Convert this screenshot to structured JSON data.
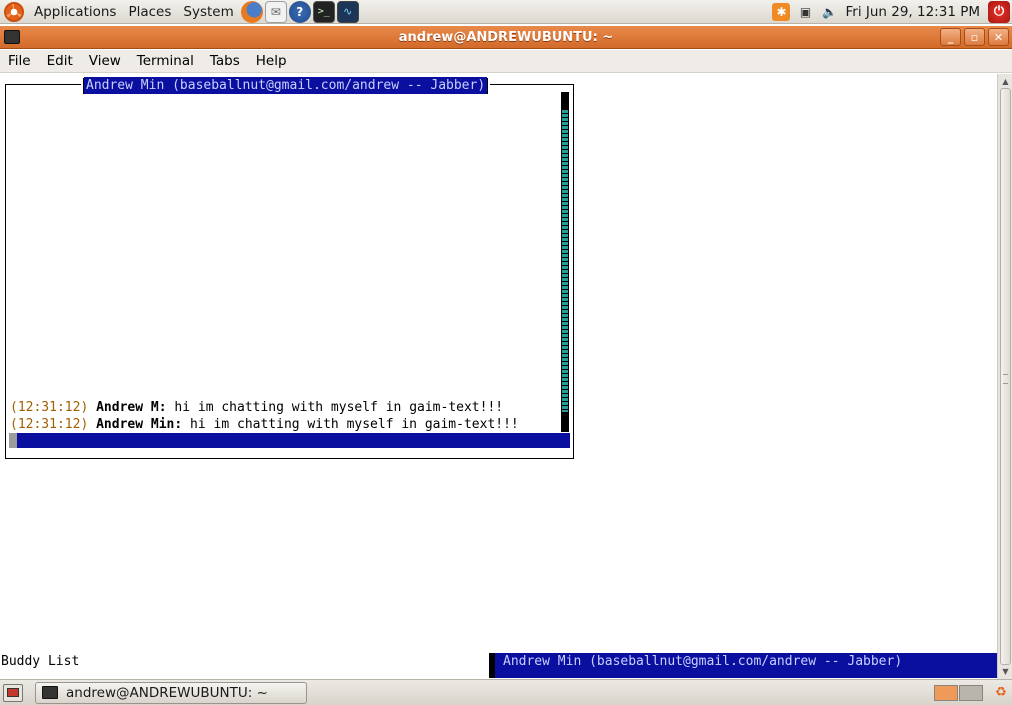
{
  "top_panel": {
    "menus": [
      "Applications",
      "Places",
      "System"
    ],
    "clock": "Fri Jun 29, 12:31 PM"
  },
  "window": {
    "title": "andrew@ANDREWUBUNTU: ~"
  },
  "menubar": {
    "items": [
      "File",
      "Edit",
      "View",
      "Terminal",
      "Tabs",
      "Help"
    ]
  },
  "chat": {
    "title": "Andrew Min (baseballnut@gmail.com/andrew -- Jabber)",
    "messages": [
      {
        "time": "(12:31:12)",
        "nick": "Andrew M:",
        "text": " hi im chatting with myself in gaim-text!!!"
      },
      {
        "time": "(12:31:12)",
        "nick": "Andrew Min:",
        "text": " hi im chatting with myself in gaim-text!!!"
      }
    ]
  },
  "status": {
    "left": "Buddy List",
    "right": "Andrew Min (baseballnut@gmail.com/andrew -- Jabber)"
  },
  "taskbar": {
    "task_label": "andrew@ANDREWUBUNTU: ~"
  },
  "colors": {
    "title_bar": "#d26a2a",
    "ncurses_blue": "#0a0fa0",
    "timestamp": "#a05f00"
  }
}
